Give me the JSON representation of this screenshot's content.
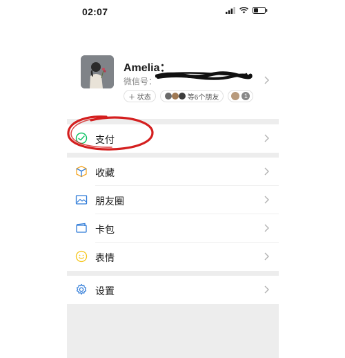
{
  "status_bar": {
    "time": "02:07",
    "icons": [
      "signal-icon",
      "wifi-icon",
      "battery-icon"
    ]
  },
  "profile": {
    "nickname": "Amelia：",
    "wechat_id_prefix": "微信号：",
    "status_chip": "＋ 状态",
    "friends_chip": "等6个朋友",
    "friends_count": "1"
  },
  "menu": {
    "pay": "支付",
    "favorites": "收藏",
    "moments": "朋友圈",
    "cards": "卡包",
    "stickers": "表情",
    "settings": "设置"
  },
  "colors": {
    "pay_icon": "#07c160",
    "favorites_icon": "#f5a623",
    "moments_icon": "#2f7bd8",
    "cards_icon": "#2f7bd8",
    "stickers_icon": "#f5c518",
    "settings_icon": "#2f7bd8",
    "annotation": "#d41f1f",
    "separator": "#ededed"
  }
}
